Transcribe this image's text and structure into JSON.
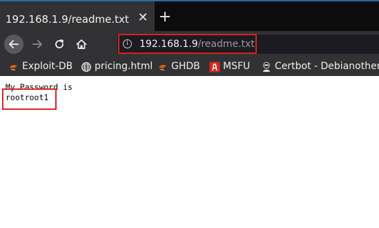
{
  "tab": {
    "title": "192.168.1.9/readme.txt",
    "close_glyph": "✕",
    "new_tab_glyph": "+"
  },
  "navbar": {
    "back_icon": "back-arrow-icon",
    "forward_icon": "forward-arrow-icon",
    "reload_icon": "reload-icon",
    "home_icon": "home-icon"
  },
  "url": {
    "info_glyph": "i",
    "host": "192.168.1.9",
    "path": "/readme.txt"
  },
  "bookmarks": [
    {
      "label": "Exploit-DB",
      "icon": "exploit-db-icon"
    },
    {
      "label": "pricing.html",
      "icon": "globe-icon"
    },
    {
      "label": "GHDB",
      "icon": "exploit-db-icon"
    },
    {
      "label": "MSFU",
      "icon": "msfu-icon"
    },
    {
      "label": "Certbot - Debianother ...",
      "icon": "certbot-icon"
    }
  ],
  "document": {
    "line1": "My Password is",
    "line2": "rootroot1"
  },
  "colors": {
    "highlight": "#d9221f",
    "toolbar": "#323234",
    "tabstrip": "#0c0c0d",
    "accent": "#1f6fb3"
  }
}
